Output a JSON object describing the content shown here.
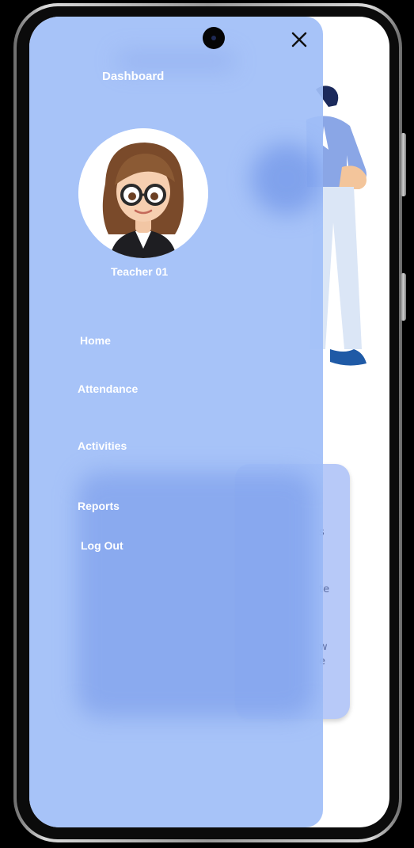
{
  "drawer": {
    "title": "Dashboard",
    "user_name": "Teacher 01",
    "close_icon": "close-icon",
    "menu": [
      {
        "label": "Home"
      },
      {
        "label": "Attendance"
      },
      {
        "label": "Activities"
      },
      {
        "label": "Reports"
      },
      {
        "label": "Log Out"
      }
    ]
  },
  "background": {
    "card_fragments": [
      "s",
      "te",
      "w",
      "e"
    ]
  },
  "colors": {
    "drawer": "#a0bef7",
    "card": "#b7c9f8",
    "text": "#ffffff"
  }
}
